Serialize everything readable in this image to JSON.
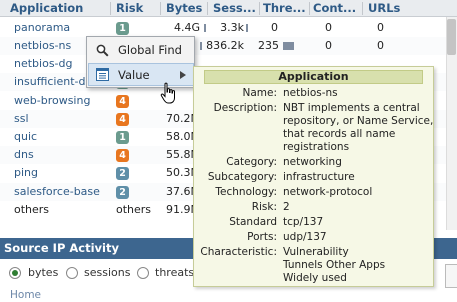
{
  "table": {
    "columns": [
      "Application",
      "Risk",
      "Bytes",
      "Sess...",
      "Thre...",
      "Cont...",
      "URLs"
    ],
    "rows": [
      {
        "application": "panorama",
        "risk": "1",
        "risk_color": "#6b9b8e",
        "bytes": "4.4G",
        "sessions": "3.3k",
        "threats": "0",
        "content": "0",
        "urls": "0"
      },
      {
        "application": "netbios-ns",
        "risk": "2",
        "risk_color": "#6b9b8e",
        "bytes": "",
        "sessions": "836.2k",
        "threats": "235",
        "content": "0",
        "urls": "0"
      },
      {
        "application": "netbios-dg",
        "risk": "",
        "risk_color": "#6b9b8e",
        "bytes": "",
        "sessions": "",
        "threats": "",
        "content": "",
        "urls": ""
      },
      {
        "application": "insufficient-data",
        "risk": "",
        "risk_color": "#6b9b8e",
        "bytes": "",
        "sessions": "",
        "threats": "",
        "content": "",
        "urls": ""
      },
      {
        "application": "web-browsing",
        "risk": "4",
        "risk_color": "#e8761f",
        "bytes": "",
        "sessions": "",
        "threats": "",
        "content": "",
        "urls": ""
      },
      {
        "application": "ssl",
        "risk": "4",
        "risk_color": "#e8761f",
        "bytes": "70.2M",
        "sessions": "",
        "threats": "",
        "content": "",
        "urls": ""
      },
      {
        "application": "quic",
        "risk": "1",
        "risk_color": "#6b9b8e",
        "bytes": "58.0M",
        "sessions": "",
        "threats": "",
        "content": "",
        "urls": ""
      },
      {
        "application": "dns",
        "risk": "4",
        "risk_color": "#e8761f",
        "bytes": "55.8M",
        "sessions": "",
        "threats": "",
        "content": "",
        "urls": ""
      },
      {
        "application": "ping",
        "risk": "2",
        "risk_color": "#5f8fa8",
        "bytes": "50.3M",
        "sessions": "",
        "threats": "",
        "content": "",
        "urls": ""
      },
      {
        "application": "salesforce-base",
        "risk": "2",
        "risk_color": "#5f8fa8",
        "bytes": "37.6M",
        "sessions": "",
        "threats": "",
        "content": "",
        "urls": ""
      },
      {
        "application": "others",
        "risk": "others",
        "risk_color": "",
        "bytes": "91.9M",
        "sessions": "",
        "threats": "",
        "content": "",
        "urls": ""
      }
    ]
  },
  "context_menu": {
    "items": [
      {
        "label": "Global Find",
        "icon": "magnifier-icon"
      },
      {
        "label": "Value",
        "icon": "list-window-icon",
        "has_submenu": true
      }
    ]
  },
  "tooltip": {
    "title": "Application",
    "fields": [
      {
        "key": "Name:",
        "value": [
          "netbios-ns"
        ]
      },
      {
        "key": "Description:",
        "value": [
          "NBT implements a central",
          "repository, or Name Service,",
          "that records all name",
          "registrations"
        ]
      },
      {
        "key": "Category:",
        "value": [
          "networking"
        ]
      },
      {
        "key": "Subcategory:",
        "value": [
          "infrastructure"
        ]
      },
      {
        "key": "Technology:",
        "value": [
          "network-protocol"
        ]
      },
      {
        "key": "Risk:",
        "value": [
          "2"
        ]
      },
      {
        "key": "Standard",
        "value": [
          "tcp/137"
        ]
      },
      {
        "key": "Ports:",
        "value": [
          "udp/137"
        ]
      },
      {
        "key": "Characteristic:",
        "value": [
          "Vulnerability",
          "Tunnels Other Apps",
          "Widely used"
        ]
      }
    ]
  },
  "source_ip": {
    "title": "Source IP Activity",
    "options": [
      {
        "label": "bytes",
        "selected": true
      },
      {
        "label": "sessions",
        "selected": false
      },
      {
        "label": "threats",
        "selected": false
      }
    ]
  },
  "footer": {
    "home": "Home"
  },
  "colors": {
    "accent": "#3d668f",
    "link": "#2e5a86",
    "risk_high": "#e8761f",
    "risk_low": "#6b9b8e",
    "tooltip_bg": "#f6f8e6"
  }
}
